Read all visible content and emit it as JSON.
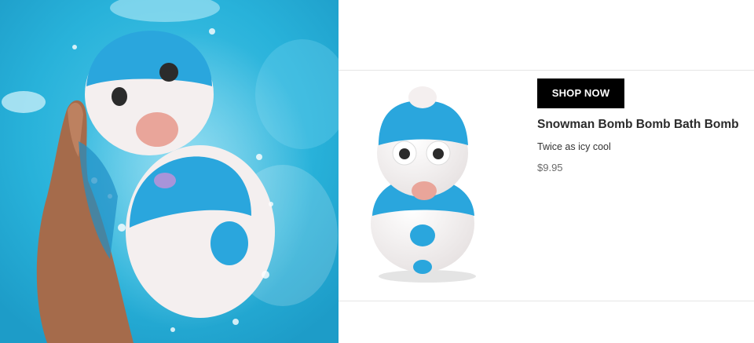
{
  "hero_image": {
    "icon": "snowman-bath-bombs-in-water-photo"
  },
  "product": {
    "image_icon": "snowman-bath-bomb-product-photo",
    "shop_button_label": "SHOP NOW",
    "name": "Snowman Bomb Bomb Bath Bomb",
    "tagline": "Twice as icy cool",
    "price": "$9.95"
  },
  "colors": {
    "water": "#2fb6dc",
    "bomb_blue": "#2aa6dd",
    "bomb_white": "#f4efef",
    "nose_pink": "#e9a59a",
    "button_bg": "#000000",
    "button_text": "#ffffff"
  }
}
